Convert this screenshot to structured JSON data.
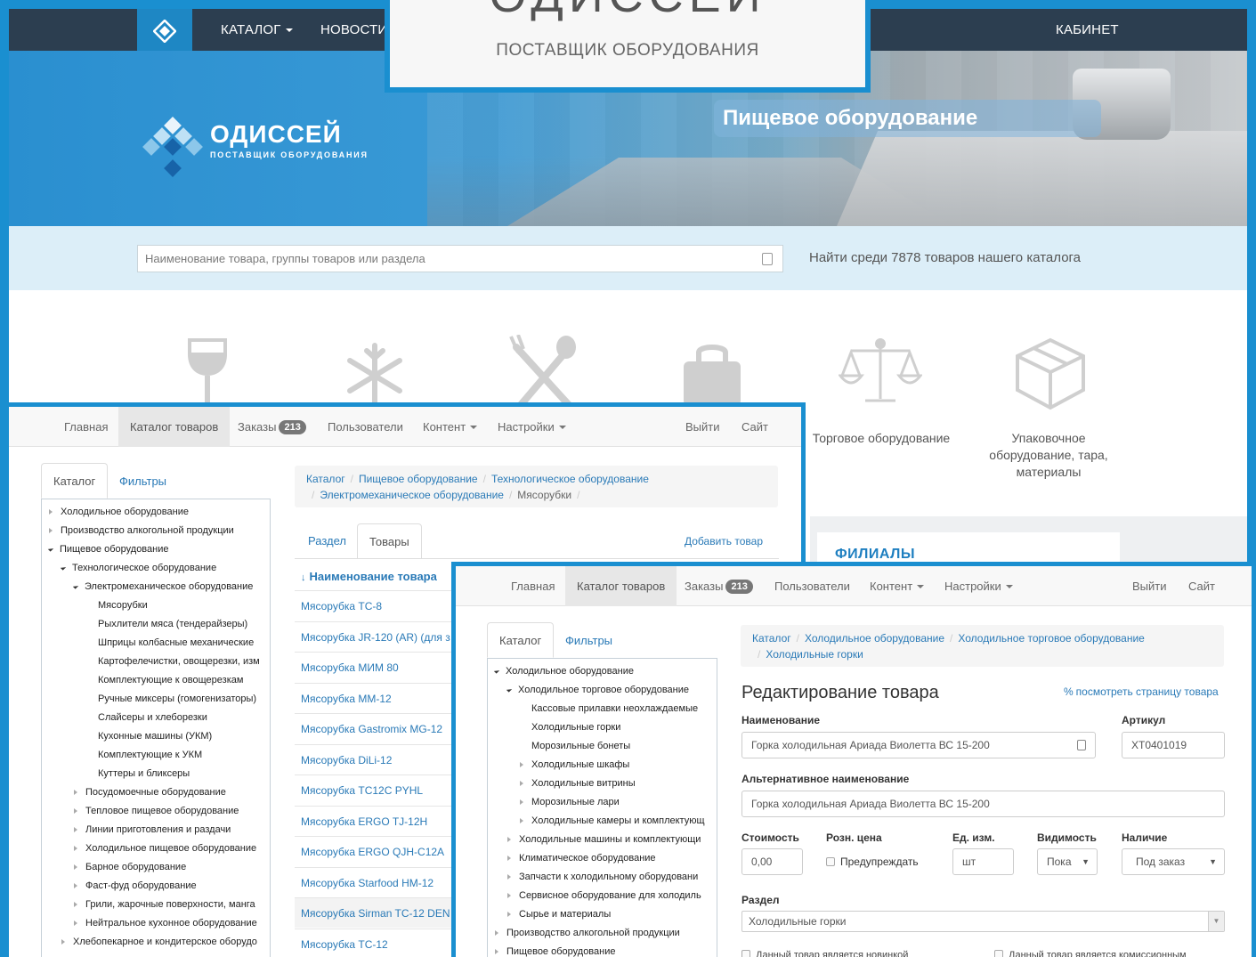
{
  "site": {
    "nav": {
      "catalog": "КАТАЛОГ",
      "news": "НОВОСТИ",
      "cabinet": "КАБИНЕТ"
    },
    "logo_text": "ОДИССЕЙ",
    "logo_subtitle": "ПОСТАВЩИК ОБОРУДОВАНИЯ",
    "hero_title": "Пищевое оборудование",
    "search_placeholder": "Наименование товара, группы товаров или раздела",
    "search_hint": "Найти среди 7878 товаров нашего каталога",
    "categories": [
      {
        "icon": "wine-glass-icon",
        "label": ""
      },
      {
        "icon": "snowflake-icon",
        "label": ""
      },
      {
        "icon": "fork-spoon-icon",
        "label": ""
      },
      {
        "icon": "bag-icon",
        "label": ""
      },
      {
        "icon": "scales-icon",
        "label": "Торговое оборудование"
      },
      {
        "icon": "box-icon",
        "label": "Упаковочное оборудование, тара, материалы"
      }
    ],
    "branches_title": "ФИЛИАЛЫ"
  },
  "logo_overlay": {
    "title": "ОДИССЕЙ",
    "subtitle": "ПОСТАВЩИК ОБОРУДОВАНИЯ"
  },
  "admin_nav": {
    "home": "Главная",
    "catalog": "Каталог товаров",
    "orders": "Заказы",
    "orders_count": "213",
    "users": "Пользователи",
    "content": "Контент",
    "settings": "Настройки",
    "logout": "Выйти",
    "site": "Сайт"
  },
  "admin1": {
    "tab_catalog": "Каталог",
    "tab_filters": "Фильтры",
    "tree": [
      {
        "level": 0,
        "state": "closed",
        "label": "Холодильное оборудование"
      },
      {
        "level": 0,
        "state": "closed",
        "label": "Производство алкогольной продукции"
      },
      {
        "level": 0,
        "state": "open",
        "label": "Пищевое оборудование"
      },
      {
        "level": 1,
        "state": "open",
        "label": "Технологическое оборудование"
      },
      {
        "level": 2,
        "state": "open",
        "label": "Электромеханическое оборудование"
      },
      {
        "level": 3,
        "state": "none",
        "label": "Мясорубки"
      },
      {
        "level": 3,
        "state": "none",
        "label": "Рыхлители мяса (тендерайзеры)"
      },
      {
        "level": 3,
        "state": "none",
        "label": "Шприцы колбасные механические"
      },
      {
        "level": 3,
        "state": "none",
        "label": "Картофелечистки, овощерезки, изм"
      },
      {
        "level": 3,
        "state": "none",
        "label": "Комплектующие к овощерезкам"
      },
      {
        "level": 3,
        "state": "none",
        "label": "Ручные миксеры (гомогенизаторы)"
      },
      {
        "level": 3,
        "state": "none",
        "label": "Слайсеры и хлеборезки"
      },
      {
        "level": 3,
        "state": "none",
        "label": "Кухонные машины (УКМ)"
      },
      {
        "level": 3,
        "state": "none",
        "label": "Комплектующие к УКМ"
      },
      {
        "level": 3,
        "state": "none",
        "label": "Куттеры и бликсеры"
      },
      {
        "level": 2,
        "state": "closed",
        "label": "Посудомоечные оборудование"
      },
      {
        "level": 2,
        "state": "closed",
        "label": "Тепловое пищевое оборудование"
      },
      {
        "level": 2,
        "state": "closed",
        "label": "Линии приготовления и раздачи"
      },
      {
        "level": 2,
        "state": "closed",
        "label": "Холодильное пищевое оборудование"
      },
      {
        "level": 2,
        "state": "closed",
        "label": "Барное оборудование"
      },
      {
        "level": 2,
        "state": "closed",
        "label": "Фаст-фуд оборудование"
      },
      {
        "level": 2,
        "state": "closed",
        "label": "Грили, жарочные поверхности, манга"
      },
      {
        "level": 2,
        "state": "closed",
        "label": "Нейтральное кухонное оборудование"
      },
      {
        "level": 1,
        "state": "closed",
        "label": "Хлебопекарное и кондитерское оборудо"
      }
    ],
    "breadcrumb": [
      "Каталог",
      "Пищевое оборудование",
      "Технологическое оборудование",
      "Электромеханическое оборудование",
      "Мясорубки"
    ],
    "tab_section": "Раздел",
    "tab_products": "Товары",
    "add_product": "Добавить товар",
    "col_name": "Наименование товара",
    "products": [
      "Мясорубка TC-8",
      "Мясорубка JR-120 (AR) (для з",
      "Мясорубка МИМ 80",
      "Мясорубка MM-12",
      "Мясорубка Gastromix MG-12",
      "Мясорубка DiLi-12",
      "Мясорубка TC12C PYHL",
      "Мясорубка ERGO TJ-12H",
      "Мясорубка ERGO QJH-C12A",
      "Мясорубка Starfood HM-12",
      "Мясорубка Sirman TC-12 DEN",
      "Мясорубка TC-12"
    ]
  },
  "admin2": {
    "tab_catalog": "Каталог",
    "tab_filters": "Фильтры",
    "tree": [
      {
        "level": 0,
        "state": "open",
        "label": "Холодильное оборудование"
      },
      {
        "level": 1,
        "state": "open",
        "label": "Холодильное торговое оборудование"
      },
      {
        "level": 2,
        "state": "none",
        "label": "Кассовые прилавки неохлаждаемые"
      },
      {
        "level": 2,
        "state": "none",
        "label": "Холодильные горки"
      },
      {
        "level": 2,
        "state": "none",
        "label": "Морозильные бонеты"
      },
      {
        "level": 2,
        "state": "closed",
        "label": "Холодильные шкафы"
      },
      {
        "level": 2,
        "state": "closed",
        "label": "Холодильные витрины"
      },
      {
        "level": 2,
        "state": "closed",
        "label": "Морозильные лари"
      },
      {
        "level": 2,
        "state": "closed",
        "label": "Холодильные камеры и комплектующ"
      },
      {
        "level": 1,
        "state": "closed",
        "label": "Холодильные машины и комплектующи"
      },
      {
        "level": 1,
        "state": "closed",
        "label": "Климатическое оборудование"
      },
      {
        "level": 1,
        "state": "closed",
        "label": "Запчасти к холодильному оборудовани"
      },
      {
        "level": 1,
        "state": "closed",
        "label": "Сервисное оборудование для холодиль"
      },
      {
        "level": 1,
        "state": "closed",
        "label": "Сырье и материалы"
      },
      {
        "level": 0,
        "state": "closed",
        "label": "Производство алкогольной продукции"
      },
      {
        "level": 0,
        "state": "closed",
        "label": "Пищевое оборудование"
      }
    ],
    "breadcrumb": [
      "Каталог",
      "Холодильное оборудование",
      "Холодильное торговое оборудование",
      "Холодильные горки"
    ],
    "heading": "Редактирование товара",
    "view_link": "посмотреть страницу товара",
    "name_label": "Наименование",
    "name_value": "Горка холодильная Ариада Виолетта ВС 15-200",
    "sku_label": "Артикул",
    "sku_value": "XT0401019",
    "alt_label": "Альтернативное наименование",
    "alt_value": "Горка холодильная Ариада Виолетта ВС 15-200",
    "cost_label": "Стоимость",
    "cost_value": "0,00",
    "retail_label": "Розн. цена",
    "warn_label": "Предупреждать",
    "unit_label": "Ед. изм.",
    "unit_value": "шт",
    "vis_label": "Видимость",
    "vis_value": "Пока",
    "avail_label": "Наличие",
    "avail_value": "Под заказ",
    "section_label": "Раздел",
    "section_value": "Холодильные горки",
    "new_check": "Данный товар является новинкой",
    "commission_check": "Данный товар является комиссионным"
  }
}
